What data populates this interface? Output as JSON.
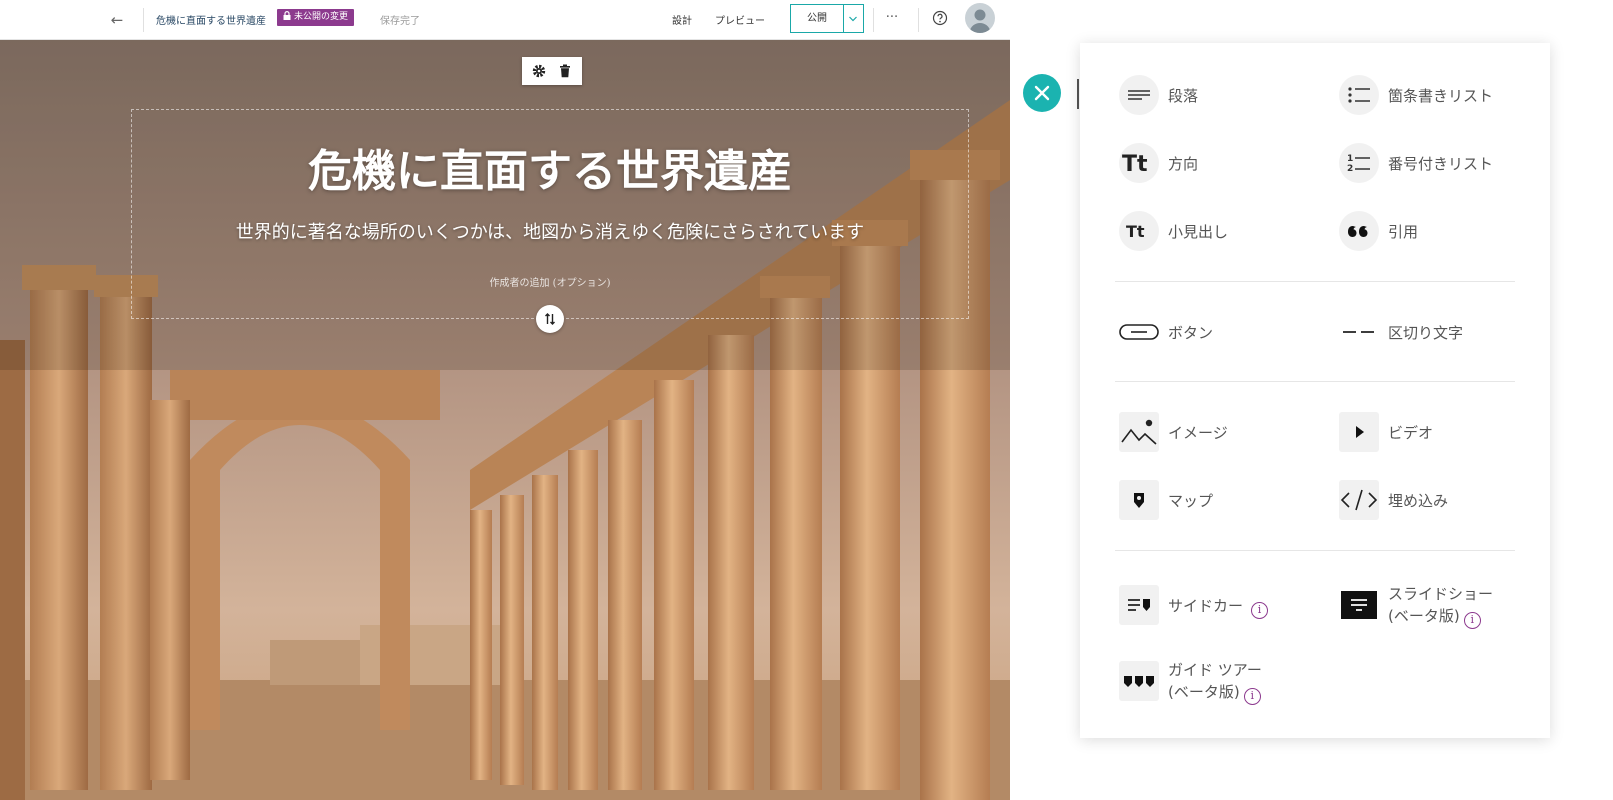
{
  "header": {
    "back_icon": "arrow-left-icon",
    "story_title": "危機に直面する世界遺産",
    "unpublished_badge": "未公開の変更",
    "save_status": "保存完了",
    "design_label": "設計",
    "preview_label": "プレビュー",
    "publish_label": "公開",
    "more_label": "···"
  },
  "hero": {
    "title": "危機に直面する世界遺産",
    "subtitle": "世界的に著名な場所のいくつかは、地図から消えゆく危険にさらされています",
    "author_placeholder": "作成者の追加 (オプション)"
  },
  "block_menu": {
    "items": [
      {
        "label": "段落",
        "icon": "paragraph-icon"
      },
      {
        "label": "箇条書きリスト",
        "icon": "bullet-list-icon"
      },
      {
        "label": "方向",
        "icon": "heading-icon"
      },
      {
        "label": "番号付きリスト",
        "icon": "numbered-list-icon"
      },
      {
        "label": "小見出し",
        "icon": "subheading-icon"
      },
      {
        "label": "引用",
        "icon": "quote-icon"
      },
      {
        "label": "ボタン",
        "icon": "button-icon"
      },
      {
        "label": "区切り文字",
        "icon": "separator-icon"
      },
      {
        "label": "イメージ",
        "icon": "image-icon"
      },
      {
        "label": "ビデオ",
        "icon": "video-icon"
      },
      {
        "label": "マップ",
        "icon": "map-icon"
      },
      {
        "label": "埋め込み",
        "icon": "embed-icon"
      },
      {
        "label": "サイドカー",
        "icon": "sidecar-icon"
      },
      {
        "label": "スライドショー",
        "label_line2": "(ベータ版)",
        "icon": "slideshow-icon"
      },
      {
        "label": "ガイド ツアー",
        "label_line2": "(ベータ版)",
        "icon": "guided-tour-icon"
      }
    ]
  },
  "colors": {
    "accent_teal": "#1bb3b0",
    "badge_purple": "#8c3a8e"
  }
}
